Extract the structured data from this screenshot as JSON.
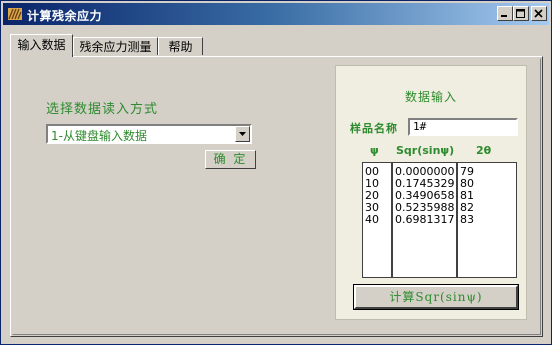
{
  "window": {
    "title": "计算残余应力",
    "colors": {
      "title_start": "#0a246a",
      "title_end": "#a6caf0",
      "accent_text": "#2e8b2e"
    }
  },
  "tabs": [
    {
      "label": "输入数据",
      "active": true
    },
    {
      "label": "残余应力测量",
      "active": false
    },
    {
      "label": "帮助",
      "active": false
    }
  ],
  "input_method": {
    "label": "选择数据读入方式",
    "selected": "1-从键盘输入数据",
    "confirm_label": "确 定"
  },
  "data_entry": {
    "title": "数据输入",
    "sample_name_label": "样品名称",
    "sample_name_value": "1#",
    "columns": [
      "ψ",
      "Sqr(sinψ)",
      "2θ"
    ],
    "psi": [
      "00",
      "10",
      "20",
      "30",
      "40"
    ],
    "sqr_sin": [
      "0.0000000",
      "0.1745329",
      "0.3490658",
      "0.5235988",
      "0.6981317"
    ],
    "two_theta": [
      "79",
      "80",
      "81",
      "82",
      "83"
    ],
    "calc_label": "计算Sqr(sinψ)"
  },
  "icons": {
    "minimize": "minimize-icon",
    "maximize": "maximize-icon",
    "close": "close-icon",
    "app": "app-icon",
    "dropdown": "chevron-down-icon"
  }
}
